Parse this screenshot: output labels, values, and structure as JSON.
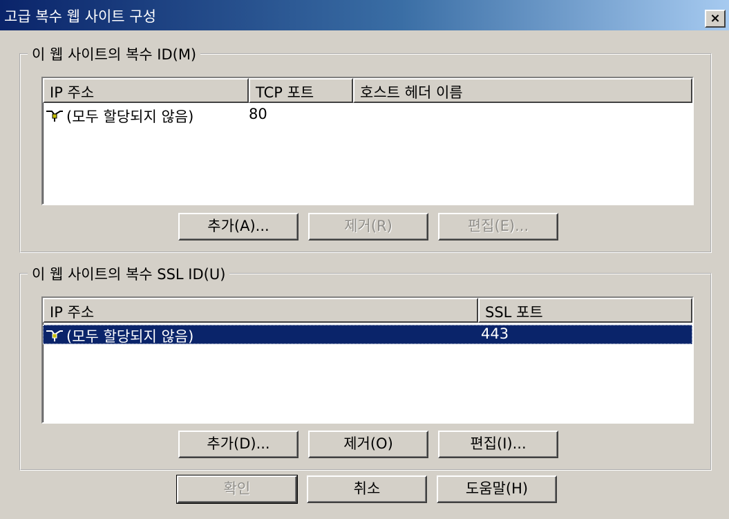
{
  "window": {
    "title": "고급 복수 웹 사이트 구성",
    "close_label": "×"
  },
  "identities": {
    "label": "이 웹 사이트의 복수 ID(M)",
    "columns": [
      "IP 주소",
      "TCP 포트",
      "호스트 헤더 이름"
    ],
    "rows": [
      {
        "ip": "(모두 할당되지 않음)",
        "port": "80",
        "host": ""
      }
    ],
    "add_button": "추가(A)...",
    "remove_button": "제거(R)",
    "edit_button": "편집(E)..."
  },
  "ssl": {
    "label": "이 웹 사이트의 복수 SSL ID(U)",
    "columns": [
      "IP 주소",
      "SSL 포트"
    ],
    "rows": [
      {
        "ip": "(모두 할당되지 않음)",
        "port": "443",
        "selected": true
      }
    ],
    "add_button": "추가(D)...",
    "remove_button": "제거(O)",
    "edit_button": "편집(I)..."
  },
  "footer": {
    "ok_button": "확인",
    "cancel_button": "취소",
    "help_button": "도움말(H)"
  },
  "icons": {
    "network_icon": "network-adapter-icon"
  },
  "colors": {
    "selection": "#0a246a",
    "titlebar": "#0a246a",
    "face": "#d4d0c8"
  }
}
